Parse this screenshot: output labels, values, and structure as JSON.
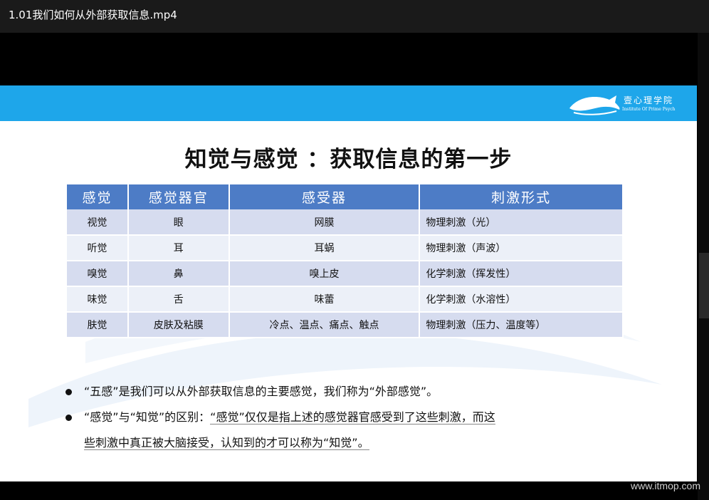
{
  "window": {
    "title": "1.01我们如何从外部获取信息.mp4"
  },
  "slide": {
    "logo": {
      "name": "壹心理学院",
      "subtitle": "Institute Of Prime Psych"
    },
    "title": "知觉与感觉 ：获取信息的第一步",
    "table": {
      "headers": [
        "感觉",
        "感觉器官",
        "感受器",
        "刺激形式"
      ],
      "rows": [
        [
          "视觉",
          "眼",
          "网膜",
          "物理刺激（光）"
        ],
        [
          "听觉",
          "耳",
          "耳蜗",
          "物理刺激（声波）"
        ],
        [
          "嗅觉",
          "鼻",
          "嗅上皮",
          "化学刺激（挥发性）"
        ],
        [
          "味觉",
          "舌",
          "味蕾",
          "化学刺激（水溶性）"
        ],
        [
          "肤觉",
          "皮肤及粘膜",
          "冷点、温点、痛点、触点",
          "物理刺激（压力、温度等）"
        ]
      ]
    },
    "bullets": [
      {
        "text": "“五感”是我们可以从外部获取信息的主要感觉，我们称为“外部感觉”。"
      },
      {
        "prefix": "“感觉”与“知觉”的区别：",
        "line1_rest": "“感觉”仅仅是指上述的感觉器官感受到了这些刺激，而这",
        "line2": "些刺激中真正被大脑接受，认知到的才可以称为“知觉”。"
      }
    ]
  },
  "watermark": "www.itmop.com",
  "colors": {
    "header_blue": "#1ea6ea",
    "table_header": "#4d7cc6",
    "row_odd": "#d6dcef",
    "row_even": "#ecf0f8"
  }
}
